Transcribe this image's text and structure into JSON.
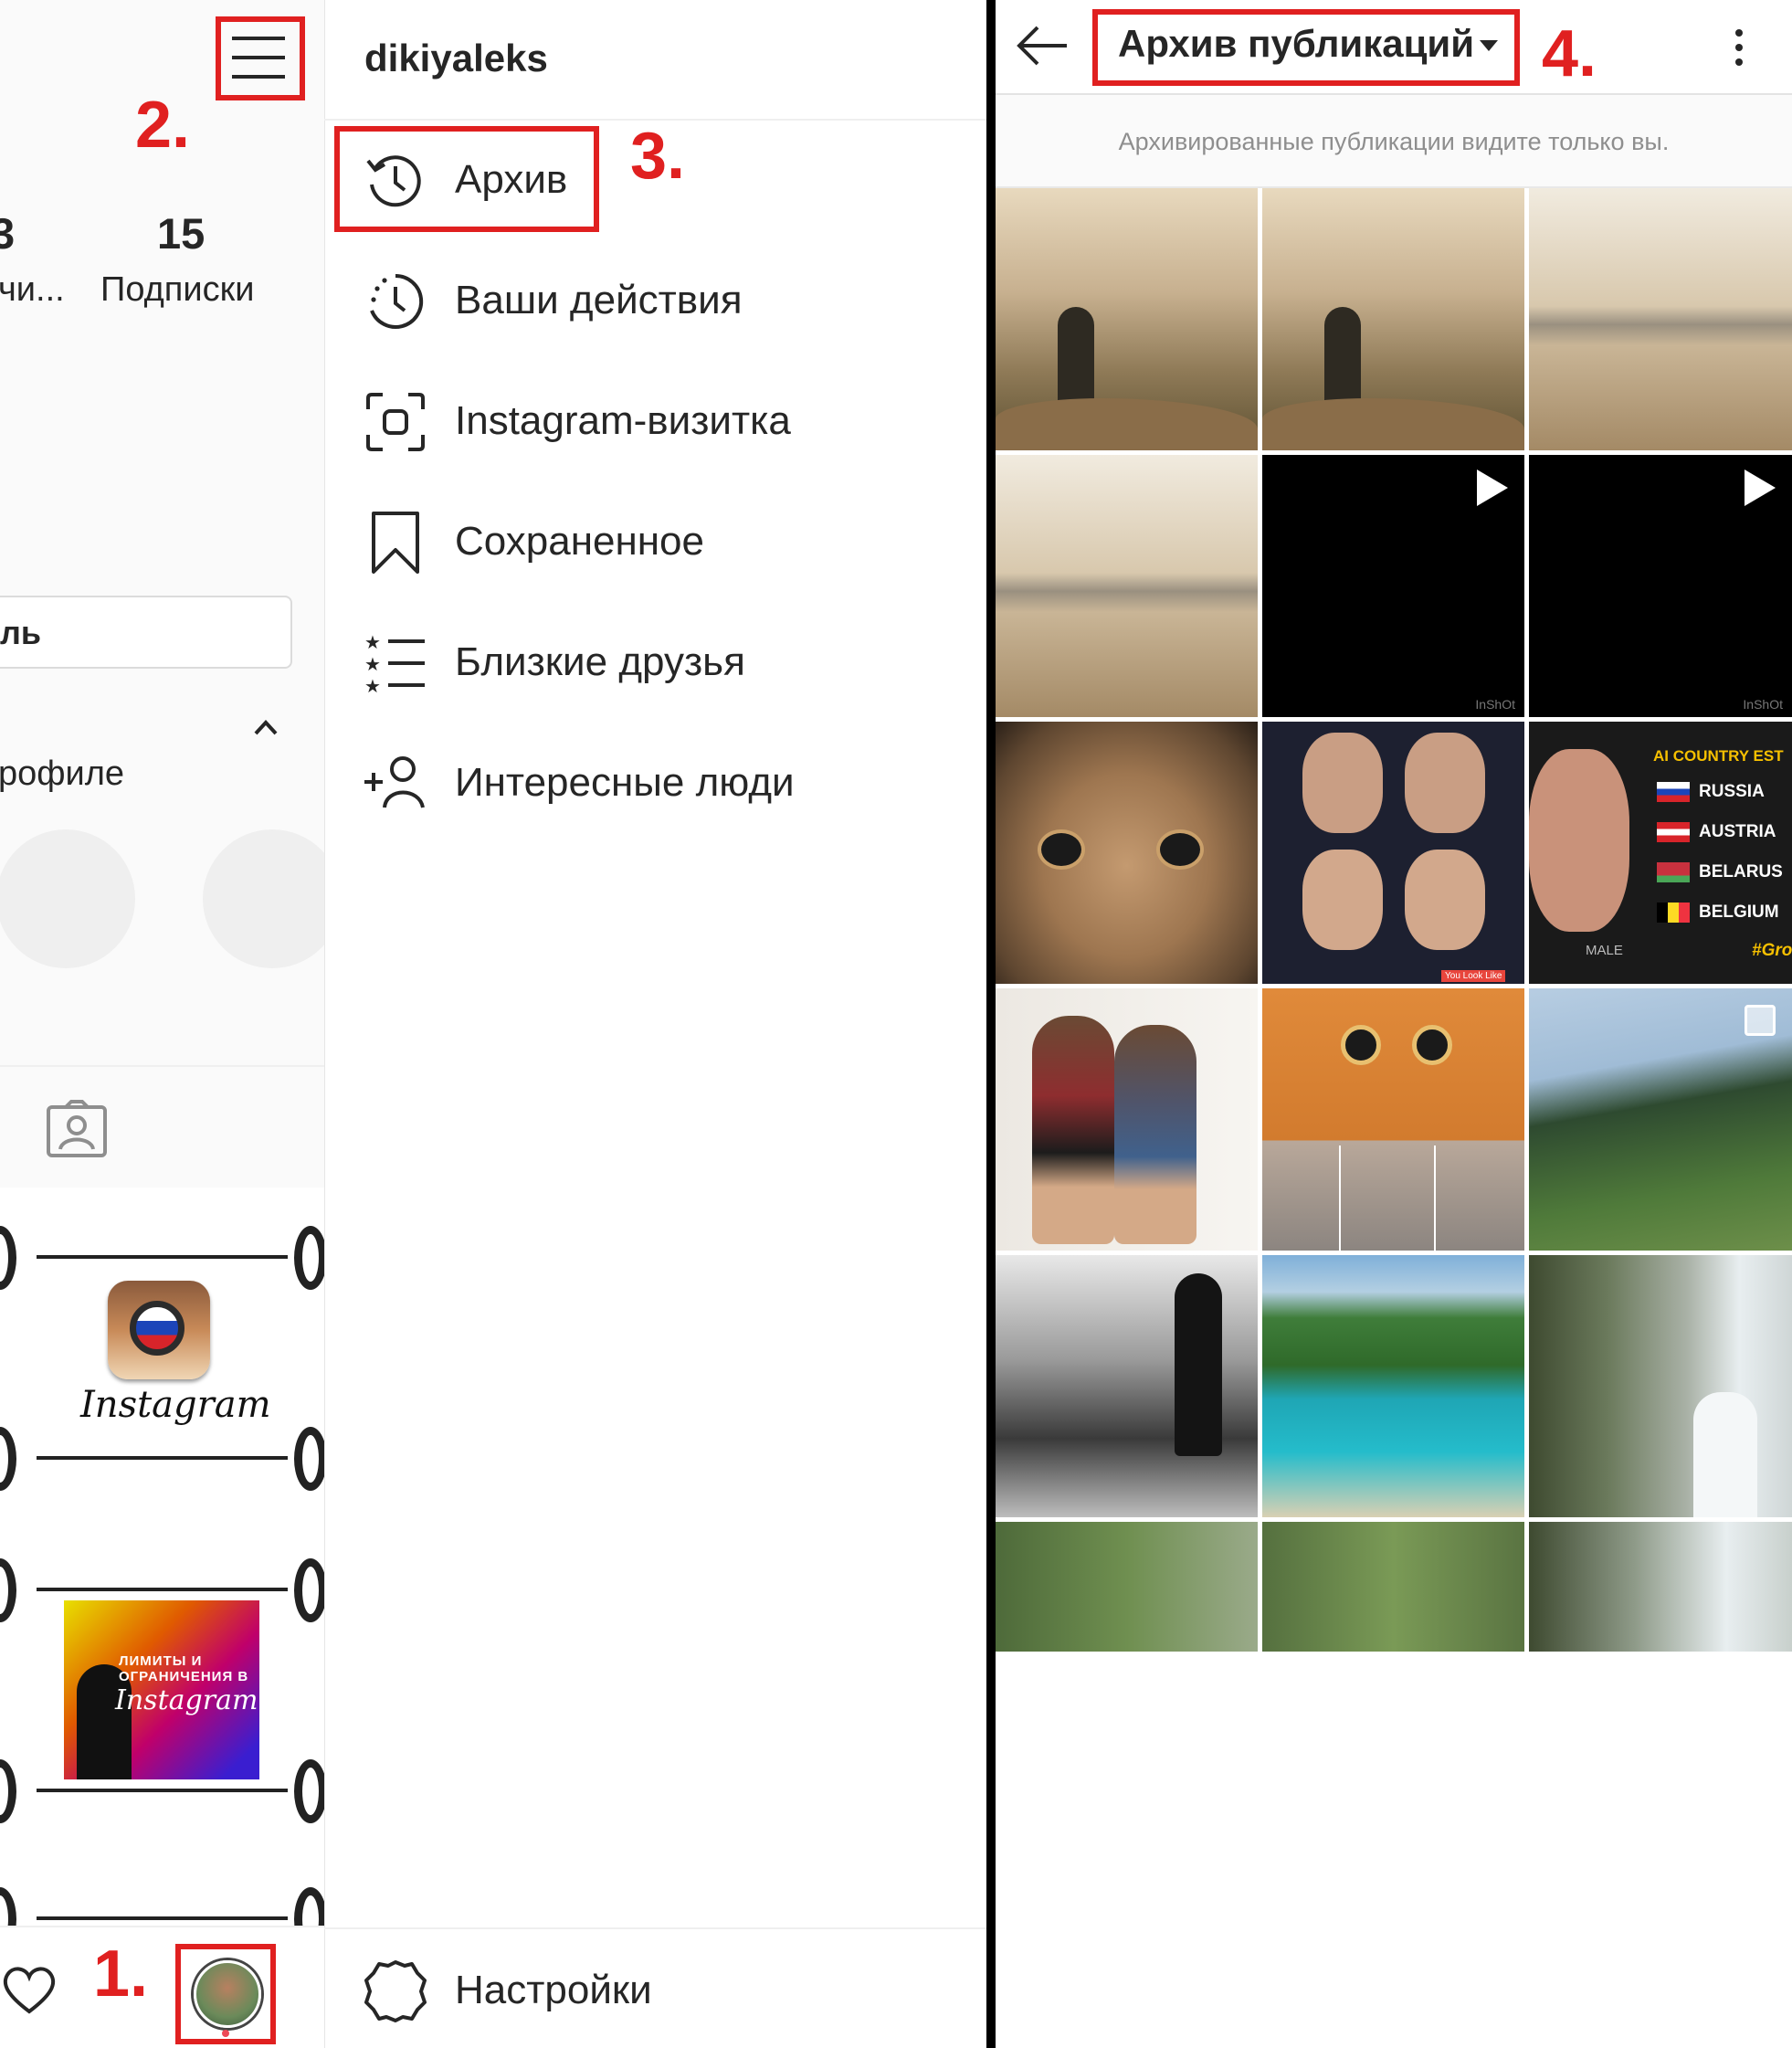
{
  "profile": {
    "followers_count_partial": "3",
    "followers_label_partial": "чи...",
    "following_count": "15",
    "following_label": "Подписки",
    "edit_button_partial": "ль",
    "profile_section_partial": "рофиле",
    "feed_logo_text": "Instagram",
    "feed_banner_text": "ЛИМИТЫ И ОГРАНИЧЕНИЯ В",
    "feed_banner_script": "Instagram"
  },
  "menu": {
    "username": "dikiyaleks",
    "items": [
      {
        "label": "Архив",
        "icon": "archive-history-icon"
      },
      {
        "label": "Ваши действия",
        "icon": "activity-clock-icon"
      },
      {
        "label": "Instagram-визитка",
        "icon": "nametag-icon"
      },
      {
        "label": "Сохраненное",
        "icon": "bookmark-icon"
      },
      {
        "label": "Близкие друзья",
        "icon": "close-friends-list-icon"
      },
      {
        "label": "Интересные люди",
        "icon": "add-person-icon"
      }
    ],
    "settings_label": "Настройки"
  },
  "archive": {
    "title": "Архив публикаций",
    "subtitle": "Архивированные публикации видите только вы.",
    "video_watermark": "InShOt",
    "country_list_title": "AI COUNTRY EST",
    "countries": [
      "RUSSIA",
      "AUSTRIA",
      "BELARUS",
      "BELGIUM"
    ],
    "gender_label": "MALE",
    "hashtag_partial": "#Gro",
    "face_caption": "You Look Like"
  },
  "annotations": {
    "step1": "1.",
    "step2": "2.",
    "step3": "3.",
    "step4": "4."
  },
  "colors": {
    "annotation_red": "#e02020",
    "text_primary": "#262626",
    "text_secondary": "#8e8e8e",
    "notification_dot": "#ed4956"
  }
}
